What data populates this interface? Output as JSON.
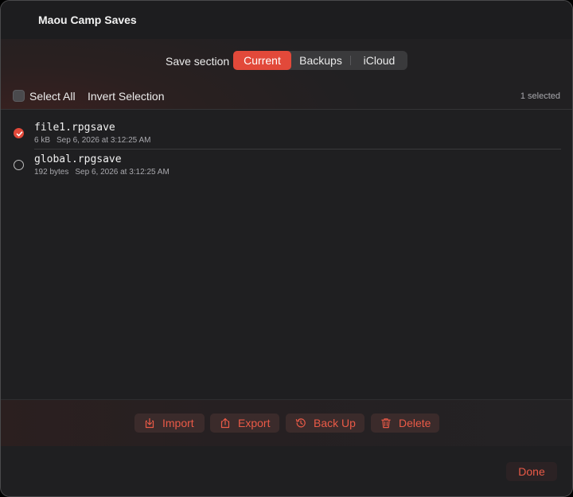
{
  "window": {
    "title": "Maou Camp Saves"
  },
  "section": {
    "label": "Save section",
    "segments": [
      {
        "label": "Current",
        "active": true
      },
      {
        "label": "Backups",
        "active": false
      },
      {
        "label": "iCloud",
        "active": false
      }
    ]
  },
  "selection": {
    "select_all_label": "Select All",
    "invert_label": "Invert Selection",
    "count_label": "1 selected"
  },
  "files": [
    {
      "name": "file1.rpgsave",
      "size": "6 kB",
      "date": "Sep 6, 2026 at 3:12:25 AM",
      "selected": true
    },
    {
      "name": "global.rpgsave",
      "size": "192 bytes",
      "date": "Sep 6, 2026 at 3:12:25 AM",
      "selected": false
    }
  ],
  "toolbar": {
    "import_label": "Import",
    "export_label": "Export",
    "backup_label": "Back Up",
    "delete_label": "Delete"
  },
  "footer": {
    "done_label": "Done"
  },
  "colors": {
    "accent": "#e2493a",
    "accent_text": "#ea5a47",
    "background": "#1f1f21"
  }
}
